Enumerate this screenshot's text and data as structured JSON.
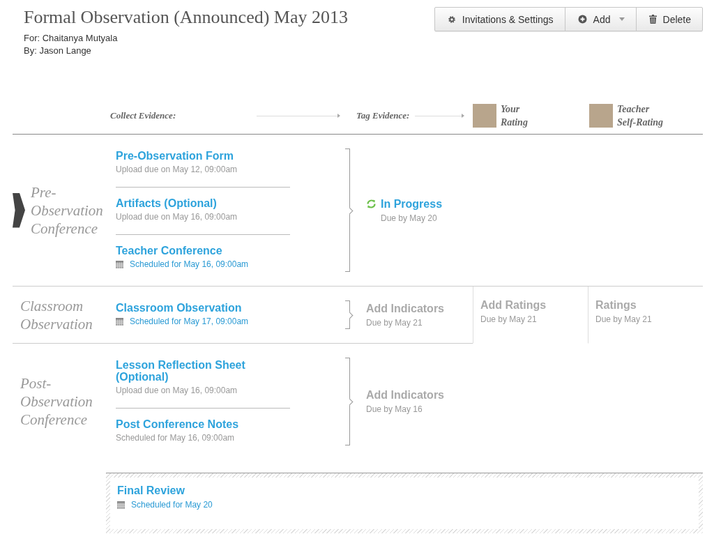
{
  "title": "Formal Observation (Announced) May 2013",
  "for_line": "For: Chaitanya Mutyala",
  "by_line": "By: Jason Lange",
  "toolbar": [
    {
      "label": "Invitations & Settings",
      "dropdown": false
    },
    {
      "label": "Add",
      "dropdown": true
    },
    {
      "label": "Delete",
      "dropdown": false
    }
  ],
  "header": {
    "collect": "Collect Evidence:",
    "tag": "Tag Evidence:",
    "your_rating": "Your Rating",
    "self_rating": "Teacher Self-Rating"
  },
  "stages": [
    {
      "title": "Pre-Observation Conference",
      "current": true,
      "items": [
        {
          "title": "Pre-Observation Form",
          "subtitle": "Upload due on May 12, 09:00am",
          "calendar": false
        },
        {
          "title": "Artifacts (Optional)",
          "subtitle": "Upload due on May 16, 09:00am",
          "calendar": false
        },
        {
          "title": "Teacher Conference",
          "subtitle": "Scheduled for May 16, 09:00am",
          "calendar": true
        }
      ],
      "tag": {
        "title": "In Progress",
        "due": "Due by May 20",
        "in_progress": true
      }
    },
    {
      "title": "Classroom Observation",
      "current": false,
      "items": [
        {
          "title": "Classroom Observation",
          "subtitle": "Scheduled for May 17, 09:00am",
          "calendar": true
        }
      ],
      "tag": {
        "title": "Add Indicators",
        "due": "Due by May 21",
        "in_progress": false
      },
      "your_rating": {
        "title": "Add Ratings",
        "due": "Due by May 21"
      },
      "self_rating": {
        "title": "Ratings",
        "due": "Due by May 21"
      }
    },
    {
      "title": "Post-Observation Conference",
      "current": false,
      "items": [
        {
          "title": "Lesson Reflection Sheet (Optional)",
          "subtitle": "Upload due on May 16, 09:00am",
          "calendar": false
        },
        {
          "title": "Post Conference Notes",
          "subtitle": "Scheduled for May 16, 09:00am",
          "calendar": false
        }
      ],
      "tag": {
        "title": "Add Indicators",
        "due": "Due by May 16",
        "in_progress": false
      }
    }
  ],
  "final": {
    "title": "Final Review",
    "subtitle": "Scheduled for May 20",
    "calendar": true
  }
}
